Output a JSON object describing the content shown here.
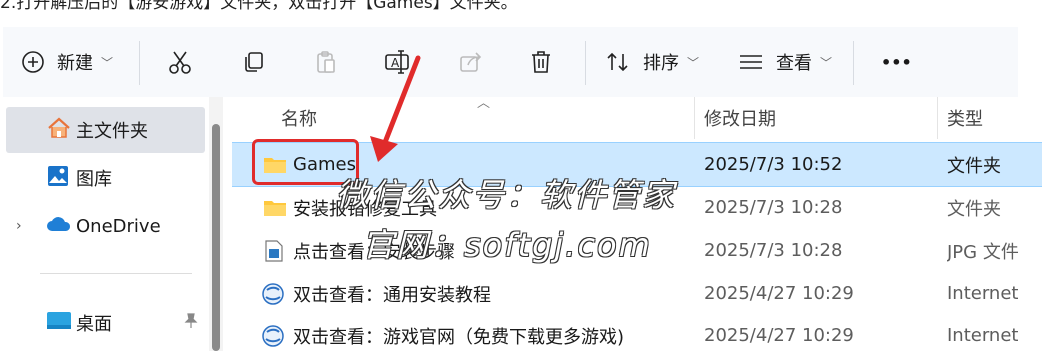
{
  "caption": "2.打开解压后的【游安游戏】文件夹，双击打开【Games】文件夹。",
  "toolbar": {
    "new_label": "新建",
    "sort_label": "排序",
    "view_label": "查看",
    "more_label": "•••"
  },
  "sidebar": {
    "items": [
      {
        "label": "主文件夹",
        "icon": "home-icon"
      },
      {
        "label": "图库",
        "icon": "gallery-icon"
      },
      {
        "label": "OneDrive",
        "icon": "cloud-icon"
      },
      {
        "label": "桌面",
        "icon": "desktop-icon"
      }
    ]
  },
  "columns": {
    "name": "名称",
    "modified": "修改日期",
    "type": "类型"
  },
  "files": [
    {
      "name": "Games",
      "modified": "2025/7/3 10:52",
      "type": "文件夹",
      "icon": "folder-icon"
    },
    {
      "name": "安装报错修复工具",
      "modified": "2025/7/3 10:28",
      "type": "文件夹",
      "icon": "folder-icon"
    },
    {
      "name": "点击查看：安装步骤",
      "modified": "2025/7/3 10:28",
      "type": "JPG 文件",
      "icon": "image-file-icon"
    },
    {
      "name": "双击查看：通用安装教程",
      "modified": "2025/4/27 10:29",
      "type": "Internet",
      "icon": "internet-shortcut-icon"
    },
    {
      "name": "双击查看：游戏官网（免费下载更多游戏)",
      "modified": "2025/4/27 10:29",
      "type": "Internet",
      "icon": "internet-shortcut-icon"
    }
  ],
  "watermark": {
    "line1": "微信公众号：软件管家",
    "line2": "官网：softgj.com"
  },
  "colors": {
    "selection": "#cce8ff",
    "annotation_red": "#e02b2b",
    "folder": "#ffc83d"
  }
}
